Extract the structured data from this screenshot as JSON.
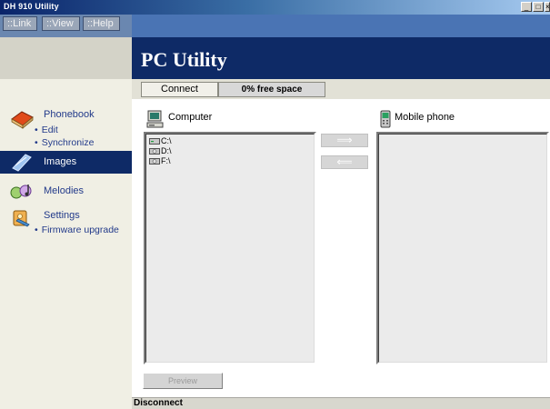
{
  "window": {
    "title": "DH 910 Utility",
    "controls": {
      "minimize": "_",
      "maximize": "□",
      "close": "×"
    }
  },
  "menu": {
    "items": [
      {
        "label": "::Link"
      },
      {
        "label": "::View"
      },
      {
        "label": "::Help"
      }
    ]
  },
  "header": {
    "app_title": "PC Utility"
  },
  "status": {
    "connect_label": "Connect",
    "free_space": "0% free space"
  },
  "sidebar": {
    "phonebook": {
      "label": "Phonebook",
      "icon": "phonebook-icon",
      "subs": [
        "Edit",
        "Synchronize"
      ]
    },
    "images": {
      "label": "Images",
      "icon": "images-icon",
      "active": true
    },
    "melodies": {
      "label": "Melodies",
      "icon": "melodies-icon"
    },
    "settings": {
      "label": "Settings",
      "icon": "settings-icon",
      "subs": [
        "Firmware upgrade"
      ]
    },
    "bullet": "•"
  },
  "computer_pane": {
    "title": "Computer",
    "icon": "computer-icon",
    "drives": [
      "C:\\",
      "D:\\",
      "F:\\"
    ]
  },
  "phone_pane": {
    "title": "Mobile phone",
    "icon": "mobile-phone-icon"
  },
  "transfer": {
    "to_phone_icon": "arrow-right-icon",
    "to_computer_icon": "arrow-left-icon",
    "to_phone_glyph": "⟹",
    "to_computer_glyph": "⟸"
  },
  "preview_label": "Preview",
  "bottom_status": "Disconnect",
  "colors": {
    "header_bg": "#0e2a66",
    "menubar_bg": "#4a74b4",
    "sidebar_bg": "#f0efe4",
    "active_item_bg": "#0e2a66",
    "link_text": "#223a8a"
  }
}
